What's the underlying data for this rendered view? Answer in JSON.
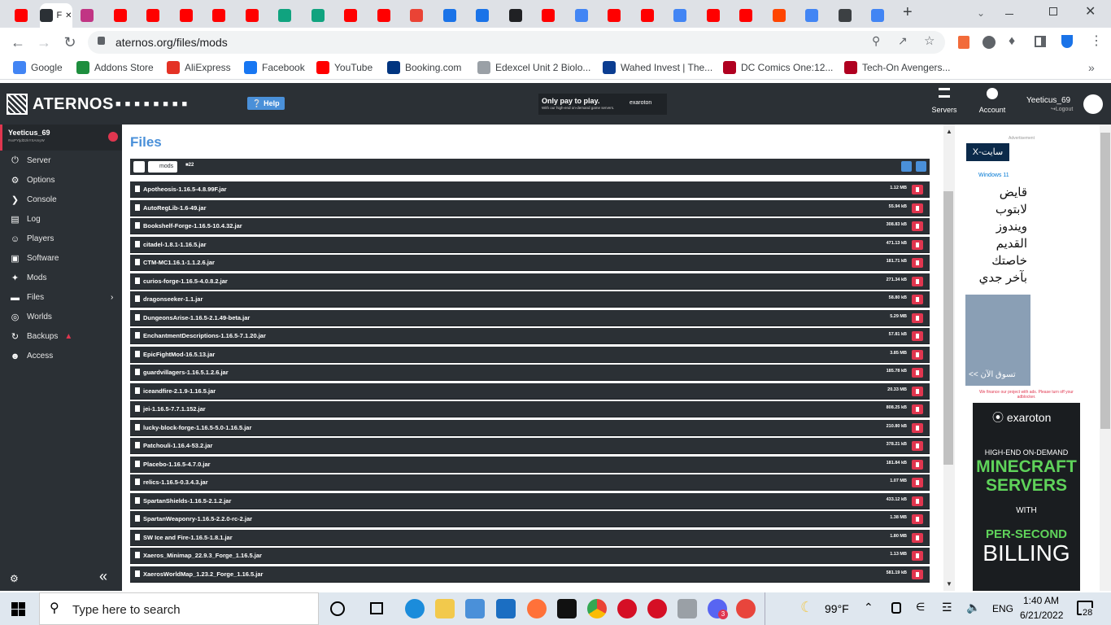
{
  "browser": {
    "active_tab_label": "F",
    "url": "aternos.org/files/mods",
    "tabs": [
      {
        "icon": "youtube-icon",
        "color": "#ff0000"
      },
      {
        "icon": "aternos-icon",
        "color": "#2b3035",
        "active": true
      },
      {
        "icon": "instagram-icon",
        "color": "#c13584"
      },
      {
        "icon": "youtube-icon",
        "color": "#ff0000"
      },
      {
        "icon": "youtube-icon",
        "color": "#ff0000"
      },
      {
        "icon": "youtube-icon",
        "color": "#ff0000"
      },
      {
        "icon": "youtube-icon",
        "color": "#ff0000"
      },
      {
        "icon": "youtube-icon",
        "color": "#ff0000"
      },
      {
        "icon": "openai-icon",
        "color": "#10a37f"
      },
      {
        "icon": "openai-icon",
        "color": "#10a37f"
      },
      {
        "icon": "youtube-icon",
        "color": "#ff0000"
      },
      {
        "icon": "youtube-icon",
        "color": "#ff0000"
      },
      {
        "icon": "gmail-icon",
        "color": "#ea4335"
      },
      {
        "icon": "pattern-icon",
        "color": "#1a73e8"
      },
      {
        "icon": "pattern-icon",
        "color": "#1a73e8"
      },
      {
        "icon": "dark-app-icon",
        "color": "#202124"
      },
      {
        "icon": "youtube-icon",
        "color": "#ff0000"
      },
      {
        "icon": "google-icon",
        "color": "#4285f4"
      },
      {
        "icon": "youtube-icon",
        "color": "#ff0000"
      },
      {
        "icon": "youtube-icon",
        "color": "#ff0000"
      },
      {
        "icon": "google-icon",
        "color": "#4285f4"
      },
      {
        "icon": "youtube-icon",
        "color": "#ff0000"
      },
      {
        "icon": "youtube-icon",
        "color": "#ff0000"
      },
      {
        "icon": "reddit-icon",
        "color": "#ff4500"
      },
      {
        "icon": "google-icon",
        "color": "#4285f4"
      },
      {
        "icon": "app-icon",
        "color": "#3c4043"
      },
      {
        "icon": "google-icon",
        "color": "#4285f4"
      }
    ],
    "bookmarks": [
      {
        "label": "Google",
        "icon": "google-icon",
        "color": "#4285f4"
      },
      {
        "label": "Addons Store",
        "icon": "addons-icon",
        "color": "#1e8e3e"
      },
      {
        "label": "AliExpress",
        "icon": "aliexpress-icon",
        "color": "#e43225"
      },
      {
        "label": "Facebook",
        "icon": "facebook-icon",
        "color": "#1877f2"
      },
      {
        "label": "YouTube",
        "icon": "youtube-icon",
        "color": "#ff0000"
      },
      {
        "label": "Booking.com",
        "icon": "booking-icon",
        "color": "#003580"
      },
      {
        "label": "Edexcel Unit 2 Biolo...",
        "icon": "doc-icon",
        "color": "#9aa0a6"
      },
      {
        "label": "Wahed Invest | The...",
        "icon": "wahed-icon",
        "color": "#0b3d91"
      },
      {
        "label": "DC Comics One:12...",
        "icon": "bb-icon",
        "color": "#b00020"
      },
      {
        "label": "Tech-On Avengers...",
        "icon": "bb-icon",
        "color": "#b00020"
      }
    ]
  },
  "site": {
    "logo": "ATERNOS",
    "help": "Help",
    "promo_title": "Only pay to play.",
    "promo_sub": "With our high-end on-demand game servers.",
    "promo_brand": "exaroton",
    "nav_servers": "Servers",
    "nav_account": "Account",
    "username": "Yeeticus_69",
    "logout": "Logout",
    "server_name": "Yeeticus_69",
    "server_id": "#xxPYtjdDzkYSAmyW",
    "sidebar": [
      {
        "label": "Server",
        "icon": "power-icon"
      },
      {
        "label": "Options",
        "icon": "gear-icon"
      },
      {
        "label": "Console",
        "icon": "terminal-icon"
      },
      {
        "label": "Log",
        "icon": "log-icon"
      },
      {
        "label": "Players",
        "icon": "players-icon"
      },
      {
        "label": "Software",
        "icon": "software-icon"
      },
      {
        "label": "Mods",
        "icon": "puzzle-icon"
      },
      {
        "label": "Files",
        "icon": "folder-icon"
      },
      {
        "label": "Worlds",
        "icon": "globe-icon"
      },
      {
        "label": "Backups",
        "icon": "backup-icon"
      },
      {
        "label": "Access",
        "icon": "access-icon"
      }
    ],
    "page_title": "Files",
    "crumb_folder": "mods",
    "crumb_count": "22",
    "files": [
      {
        "name": "Apotheosis-1.16.5-4.8.99F.jar",
        "size": "1.12 MB"
      },
      {
        "name": "AutoRegLib-1.6-49.jar",
        "size": "55.94 kB"
      },
      {
        "name": "Bookshelf-Forge-1.16.5-10.4.32.jar",
        "size": "308.83 kB"
      },
      {
        "name": "citadel-1.8.1-1.16.5.jar",
        "size": "471.13 kB"
      },
      {
        "name": "CTM-MC1.16.1-1.1.2.6.jar",
        "size": "181.71 kB"
      },
      {
        "name": "curios-forge-1.16.5-4.0.8.2.jar",
        "size": "271.34 kB"
      },
      {
        "name": "dragonseeker-1.1.jar",
        "size": "58.80 kB"
      },
      {
        "name": "DungeonsArise-1.16.5-2.1.49-beta.jar",
        "size": "5.29 MB"
      },
      {
        "name": "EnchantmentDescriptions-1.16.5-7.1.20.jar",
        "size": "57.81 kB"
      },
      {
        "name": "EpicFightMod-16.5.13.jar",
        "size": "3.85 MB"
      },
      {
        "name": "guardvillagers-1.16.5.1.2.6.jar",
        "size": "185.78 kB"
      },
      {
        "name": "iceandfire-2.1.9-1.16.5.jar",
        "size": "20.33 MB"
      },
      {
        "name": "jei-1.16.5-7.7.1.152.jar",
        "size": "808.25 kB"
      },
      {
        "name": "lucky-block-forge-1.16.5-5.0-1.16.5.jar",
        "size": "210.80 kB"
      },
      {
        "name": "Patchouli-1.16.4-53.2.jar",
        "size": "378.21 kB"
      },
      {
        "name": "Placebo-1.16.5-4.7.0.jar",
        "size": "181.84 kB"
      },
      {
        "name": "relics-1.16.5-0.3.4.3.jar",
        "size": "1.07 MB"
      },
      {
        "name": "SpartanShields-1.16.5-2.1.2.jar",
        "size": "433.12 kB"
      },
      {
        "name": "SpartanWeaponry-1.16.5-2.2.0-rc-2.jar",
        "size": "1.38 MB"
      },
      {
        "name": "SW Ice and Fire-1.16.5-1.8.1.jar",
        "size": "1.80 MB"
      },
      {
        "name": "Xaeros_Minimap_22.9.3_Forge_1.16.5.jar",
        "size": "1.13 MB"
      },
      {
        "name": "XaerosWorldMap_1.23.2_Forge_1.16.5.jar",
        "size": "581.19 kB"
      }
    ],
    "ad_label": "Advertisement",
    "ad1_brand": "X-سايت",
    "ad1_os": "Windows 11",
    "ad1_text": "قايض لابتوب ويندوز القديم خاصتك بآخر جدي",
    "ad1_cta": "تسوق الآن >>",
    "ad_notice": "We finance our project with ads. Please turn off your adblocker.",
    "ad2_brand": "exaroton",
    "ad2_line1": "HIGH-END ON-DEMAND",
    "ad2_line2": "MINECRAFT SERVERS",
    "ad2_line3": "WITH",
    "ad2_line4": "PER-SECOND",
    "ad2_line5": "BILLING"
  },
  "taskbar": {
    "search_placeholder": "Type here to search",
    "weather": "99°F",
    "lang": "ENG",
    "time": "1:40 AM",
    "date": "6/21/2022",
    "notifications": "28",
    "discord_badge": "3"
  }
}
